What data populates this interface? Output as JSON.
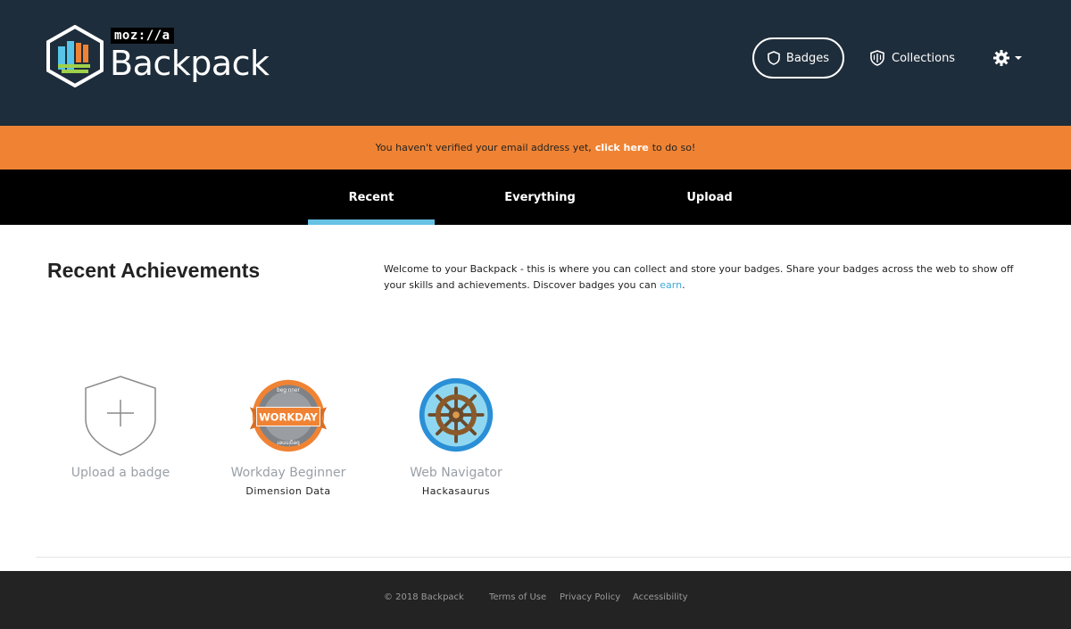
{
  "header": {
    "logo_mozilla": "moz://a",
    "logo_title": "Backpack",
    "nav": {
      "badges_label": "Badges",
      "collections_label": "Collections"
    }
  },
  "alert": {
    "text_before": "You haven't verified your email address yet,",
    "link_text": "click here",
    "text_after": "to do so!"
  },
  "tabs": [
    {
      "label": "Recent",
      "active": true
    },
    {
      "label": "Everything",
      "active": false
    },
    {
      "label": "Upload",
      "active": false
    }
  ],
  "main": {
    "title": "Recent Achievements",
    "welcome_text": "Welcome to your Backpack - this is where you can collect and store your badges. Share your badges across the web to show off your skills and achievements. Discover badges you can",
    "earn_link": "earn",
    "welcome_period": "."
  },
  "badges": [
    {
      "name": "Upload a badge",
      "issuer": "",
      "icon": "upload-badge-icon"
    },
    {
      "name": "Workday Beginner",
      "issuer": "Dimension Data",
      "ribbon_text": "WORKDAY",
      "arc_top": "beg·nner",
      "arc_bottom": "beginner",
      "icon": "workday-badge-icon"
    },
    {
      "name": "Web Navigator",
      "issuer": "Hackasaurus",
      "icon": "ship-wheel-badge-icon"
    }
  ],
  "footer": {
    "copyright": "© 2018 Backpack",
    "terms": "Terms of Use",
    "privacy": "Privacy Policy",
    "accessibility": "Accessibility"
  },
  "colors": {
    "header_bg": "#1e2d3b",
    "alert_bg": "#f08333",
    "tabs_bg": "#000000",
    "tab_active_underline": "#67c2e4",
    "link": "#3fa9d8",
    "footer_bg": "#232323"
  }
}
